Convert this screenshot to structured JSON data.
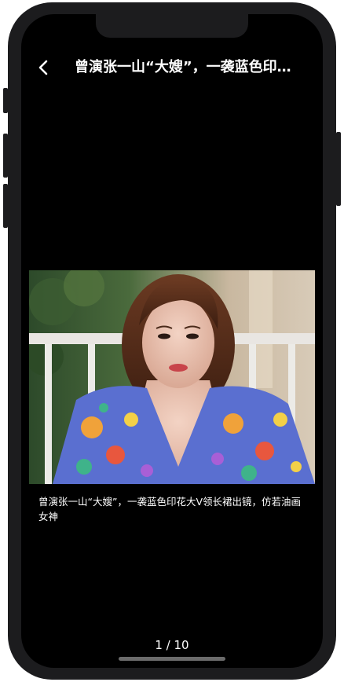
{
  "header": {
    "back_icon": "chevron-left-icon",
    "title": "曾演张一山“大嫂”，一袭蓝色印花大V领长裙出镜，仿若油画女神"
  },
  "gallery": {
    "caption": "曾演张一山“大嫂”，一袭蓝色印花大V领长裙出镜，仿若油画女神",
    "current_page": 1,
    "total_pages": 10,
    "pager_text": "1 / 10"
  },
  "colors": {
    "screen_background": "#000000",
    "text": "#ffffff",
    "frame": "#1c1c1e"
  }
}
